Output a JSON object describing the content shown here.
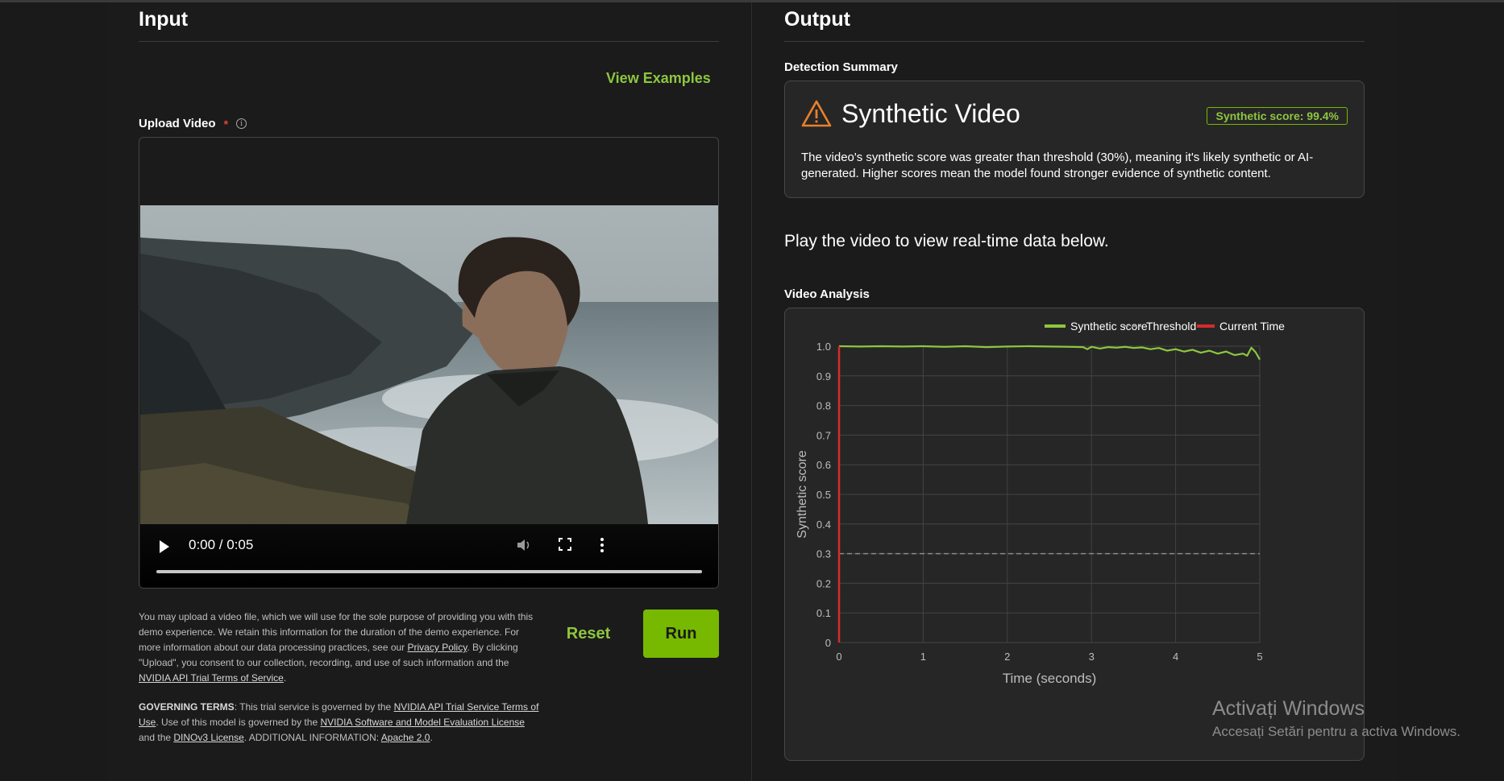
{
  "input": {
    "title": "Input",
    "view_examples": "View Examples",
    "upload_label": "Upload Video",
    "required_mark": "*",
    "info_glyph": "i",
    "player": {
      "time": "0:00 / 0:05",
      "progress": 0.0
    },
    "notice_p1_a": "You may upload a video file, which we will use for the sole purpose of providing you with this demo experience. We retain this information for the duration of the demo experience. For more information about our data processing practices, see our ",
    "notice_p1_link1": "Privacy Policy",
    "notice_p1_b": ". By clicking \"Upload\", you consent to our collection, recording, and use of such information and the ",
    "notice_p1_link2": "NVIDIA API Trial Terms of Service",
    "notice_p1_c": ".",
    "notice_p2_bold": "GOVERNING TERMS",
    "notice_p2_a": ": This trial service is governed by the ",
    "notice_p2_link1": "NVIDIA API Trial Service Terms of Use",
    "notice_p2_b": ". Use of this model is governed by the ",
    "notice_p2_link2": "NVIDIA Software and Model Evaluation License",
    "notice_p2_c": " and the ",
    "notice_p2_link3": "DINOv3 License",
    "notice_p2_d": ". ADDITIONAL INFORMATION: ",
    "notice_p2_link4": "Apache 2.0",
    "notice_p2_e": ".",
    "reset_label": "Reset",
    "run_label": "Run"
  },
  "output": {
    "title": "Output",
    "detection_summary_label": "Detection Summary",
    "verdict": "Synthetic Video",
    "score_badge": "Synthetic score: 99.4%",
    "summary_text": "The video's synthetic score was greater than threshold (30%), meaning it's likely synthetic or AI-generated. Higher scores mean the model found stronger evidence of synthetic content.",
    "play_hint": "Play the video to view real-time data below.",
    "video_analysis_label": "Video Analysis"
  },
  "colors": {
    "accent": "#76b900",
    "accent_text": "#8ec63f",
    "warning": "#e8802c",
    "current_time": "#d62b2b",
    "threshold": "#8a8a8a"
  },
  "chart_data": {
    "type": "line",
    "xlabel": "Time (seconds)",
    "ylabel": "Synthetic score",
    "xlim": [
      0,
      5
    ],
    "ylim": [
      0,
      1
    ],
    "x_ticks": [
      "0",
      "1",
      "2",
      "3",
      "4",
      "5"
    ],
    "y_ticks": [
      "0",
      "0.1",
      "0.2",
      "0.3",
      "0.4",
      "0.5",
      "0.6",
      "0.7",
      "0.8",
      "0.9",
      "1.0"
    ],
    "legend": [
      "Synthetic score",
      "Threshold",
      "Current Time"
    ],
    "legend_position": "top-right",
    "grid": true,
    "threshold": 0.3,
    "current_time": 0,
    "series": [
      {
        "name": "Synthetic score",
        "x": [
          0,
          0.25,
          0.5,
          0.75,
          1.0,
          1.25,
          1.5,
          1.75,
          2.0,
          2.25,
          2.5,
          2.75,
          2.9,
          2.95,
          3.0,
          3.1,
          3.2,
          3.3,
          3.4,
          3.5,
          3.6,
          3.7,
          3.8,
          3.9,
          4.0,
          4.1,
          4.2,
          4.3,
          4.4,
          4.5,
          4.6,
          4.7,
          4.8,
          4.85,
          4.9,
          4.95,
          5.0
        ],
        "values": [
          1.0,
          0.999,
          1.0,
          0.999,
          1.0,
          0.998,
          1.0,
          0.997,
          0.999,
          1.0,
          0.999,
          0.998,
          0.997,
          0.99,
          0.998,
          0.992,
          0.997,
          0.995,
          0.998,
          0.994,
          0.996,
          0.99,
          0.994,
          0.985,
          0.99,
          0.982,
          0.988,
          0.978,
          0.985,
          0.975,
          0.982,
          0.97,
          0.975,
          0.968,
          0.995,
          0.98,
          0.955
        ]
      }
    ]
  },
  "watermark": {
    "line1": "Activați Windows",
    "line2": "Accesați Setări pentru a activa Windows."
  }
}
